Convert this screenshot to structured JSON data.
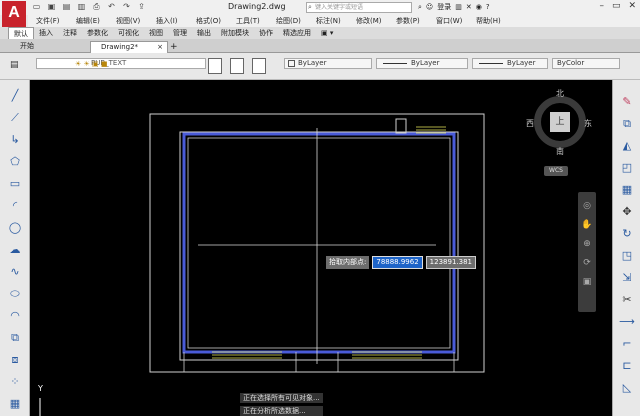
{
  "app": {
    "logo": "A",
    "title": "Drawing2.dwg"
  },
  "search": {
    "placeholder": "键入关键字或短语"
  },
  "user": {
    "login": "登录"
  },
  "menu": [
    "文件(F)",
    "编辑(E)",
    "视图(V)",
    "插入(I)",
    "格式(O)",
    "工具(T)",
    "绘图(D)",
    "标注(N)",
    "修改(M)",
    "参数(P)",
    "窗口(W)",
    "帮助(H)"
  ],
  "ribbon_tabs": [
    "默认",
    "插入",
    "注释",
    "参数化",
    "可视化",
    "视图",
    "管理",
    "输出",
    "附加模块",
    "协作",
    "精选应用"
  ],
  "doc_tabs": {
    "start": "开始",
    "current": "Drawing2*",
    "close": "×",
    "add": "+"
  },
  "properties": {
    "layer": "PUB_TEXT",
    "color": "ByLayer",
    "linetype": "ByLayer",
    "lineweight": "ByLayer",
    "plotstyle": "ByColor"
  },
  "viewcube": {
    "north": "北",
    "south": "南",
    "east": "东",
    "west": "西",
    "top": "上",
    "wcs": "WCS"
  },
  "dynamic_input": {
    "prompt": "拾取内部点:",
    "x": "78888.9962",
    "y": "123891.381"
  },
  "command_lines": [
    "正在选择所有可见对象...",
    "正在分析所选数据..."
  ],
  "ucs": {
    "y": "Y"
  },
  "colors": {
    "accent_blue": "#4a5bd8",
    "yellow": "#e8e85a",
    "canvas": "#000000"
  }
}
